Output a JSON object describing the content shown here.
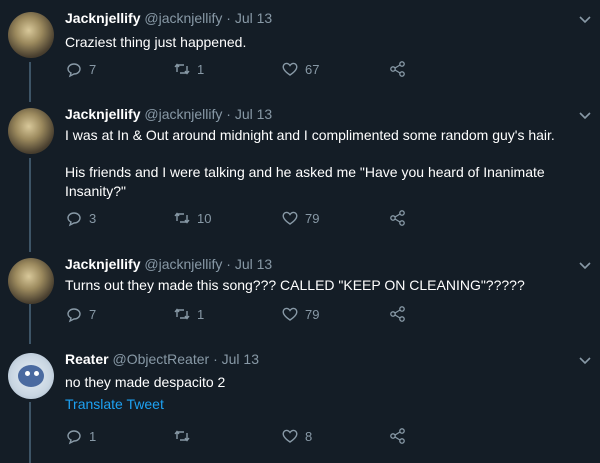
{
  "tweets": [
    {
      "author": "Jacknjellify",
      "handle": "@jacknjellify",
      "date": "Jul 13",
      "text": "Craziest thing just happened.",
      "replies": "7",
      "retweets": "1",
      "likes": "67"
    },
    {
      "author": "Jacknjellify",
      "handle": "@jacknjellify",
      "date": "Jul 13",
      "text_p1": "I was at In & Out around midnight and I complimented some random guy's hair.",
      "text_p2": "His friends and I were talking and he asked me \"Have you heard of Inanimate Insanity?\"",
      "replies": "3",
      "retweets": "10",
      "likes": "79"
    },
    {
      "author": "Jacknjellify",
      "handle": "@jacknjellify",
      "date": "Jul 13",
      "text": "Turns out they made this song??? CALLED \"KEEP ON CLEANING\"?????",
      "replies": "7",
      "retweets": "1",
      "likes": "79"
    },
    {
      "author": "Reater",
      "handle": "@ObjectReater",
      "date": "Jul 13",
      "text": "no they made despacito 2",
      "translate": "Translate Tweet",
      "replies": "1",
      "retweets": "",
      "likes": "8"
    }
  ],
  "separator": " · ",
  "colors": {
    "background": "#141d26",
    "muted": "#8899a6",
    "link": "#1da1f2",
    "thread_line": "#3d5466"
  }
}
